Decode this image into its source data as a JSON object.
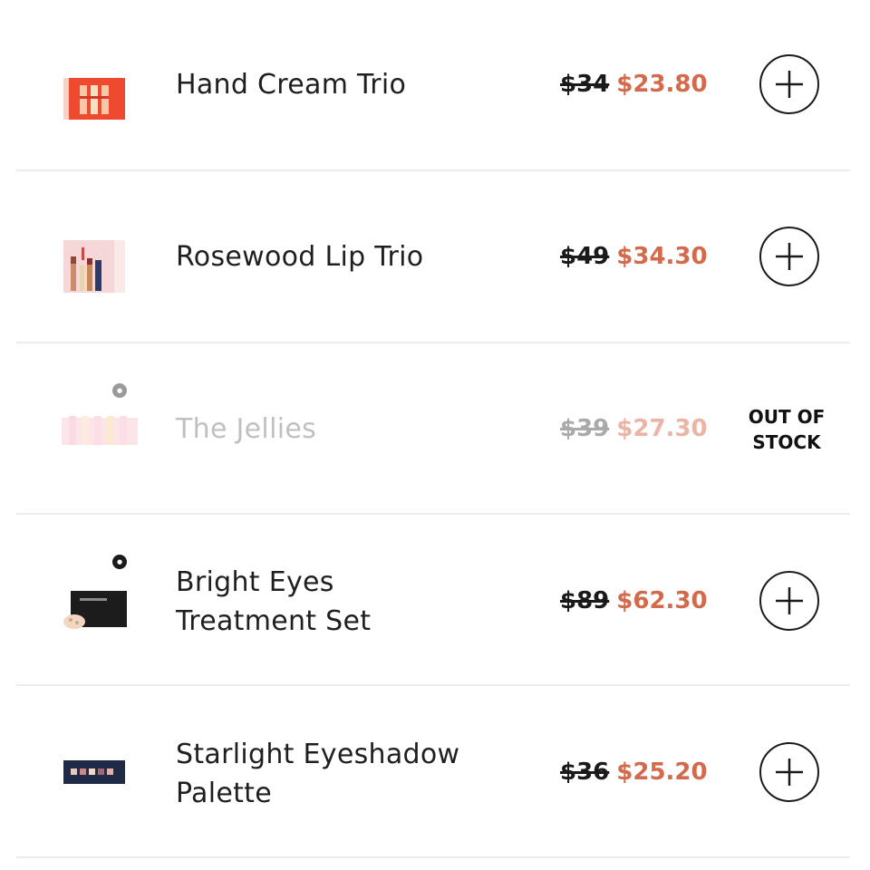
{
  "products": [
    {
      "name_lines": [
        "Hand Cream Trio"
      ],
      "old_price": "$34",
      "new_price": "$23.80",
      "action": "add",
      "thumb_icon": "hand-cream-trio-product-image"
    },
    {
      "name_lines": [
        "Rosewood Lip Trio"
      ],
      "old_price": "$49",
      "new_price": "$34.30",
      "action": "add",
      "thumb_icon": "lip-trio-product-image"
    },
    {
      "name_lines": [
        "The Jellies"
      ],
      "old_price": "$39",
      "new_price": "$27.30",
      "action": "out_of_stock",
      "status_lines": [
        "OUT OF",
        "STOCK"
      ],
      "thumb_icon": "jellies-product-image"
    },
    {
      "name_lines": [
        "Bright Eyes",
        "Treatment Set"
      ],
      "old_price": "$89",
      "new_price": "$62.30",
      "action": "add",
      "thumb_icon": "eye-treatment-set-product-image"
    },
    {
      "name_lines": [
        "Starlight Eyeshadow",
        "Palette"
      ],
      "old_price": "$36",
      "new_price": "$25.20",
      "action": "add",
      "thumb_icon": "eyeshadow-palette-product-image"
    }
  ],
  "colors": {
    "sale_price": "#d46a4c",
    "sale_price_disabled": "#ebb4a5",
    "divider": "#ececec",
    "text": "#1f1f1f"
  },
  "icons": {
    "add": "plus-circle-icon"
  }
}
